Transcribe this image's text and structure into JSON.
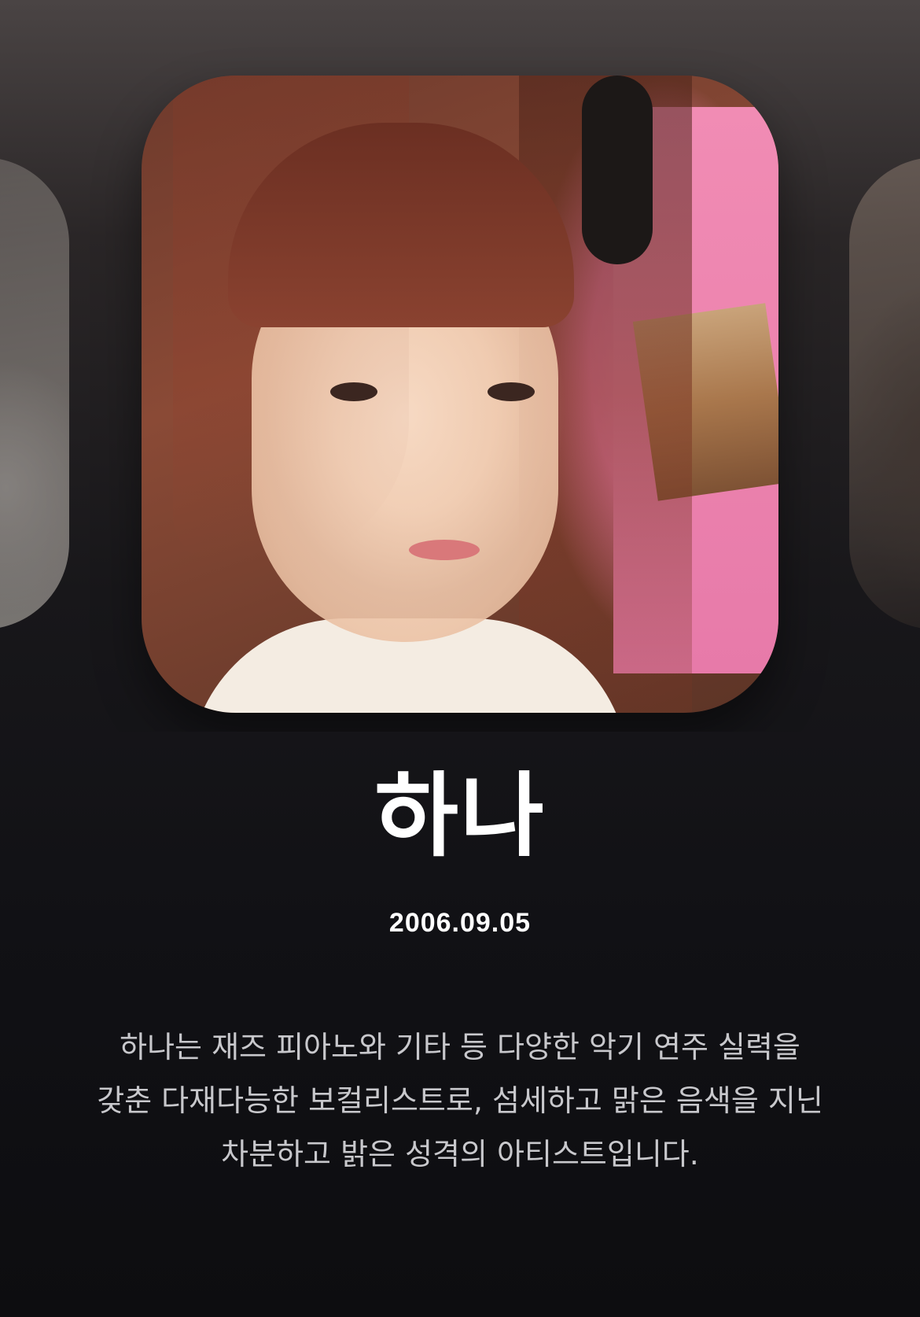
{
  "carousel": {
    "current_member": {
      "photo_icon": "profile-photo",
      "name": "하나",
      "birthday": "2006.09.05",
      "description": "하나는 재즈 피아노와 기타 등 다양한 악기 연주 실력을 갖춘 다재다능한 보컬리스트로, 섬세하고 맑은 음색을 지닌 차분하고 밝은 성격의 아티스트입니다."
    }
  },
  "colors": {
    "background_top": "#4a4444",
    "background_bottom": "#0d0d10",
    "name_text": "#ffffff",
    "description_text": "#c8c8cc"
  }
}
